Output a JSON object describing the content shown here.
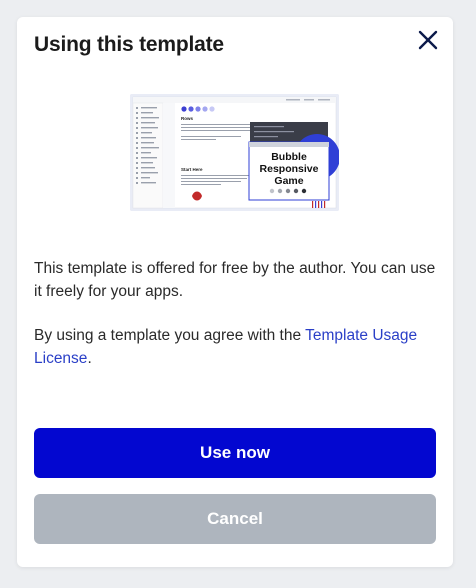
{
  "modal": {
    "title": "Using this template",
    "close_icon": "close-icon",
    "preview": {
      "rows_label": "Rows",
      "start_label": "Start Here",
      "badge_line1": "Bubble",
      "badge_line2": "Responsive",
      "badge_line3": "Game"
    },
    "description": {
      "paragraph1": "This template is offered for free by the author. You can use it freely for your apps.",
      "paragraph2_prefix": "By using a template you agree with the ",
      "paragraph2_link": "Template Usage License",
      "paragraph2_suffix": "."
    },
    "buttons": {
      "primary_label": "Use now",
      "secondary_label": "Cancel"
    },
    "colors": {
      "primary": "#0307d0",
      "secondary": "#aeb5be",
      "link": "#2a3fc7"
    }
  }
}
